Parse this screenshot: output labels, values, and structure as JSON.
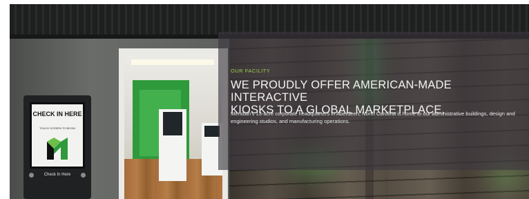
{
  "section": {
    "eyebrow": "OUR FACILITY",
    "headline": "WE PROUDLY OFFER AMERICAN-MADE INTERACTIVE\nKIOSKS TO A GLOBAL MARKETPLACE.",
    "body": "Meridian's 13-acre corporate headquarters in Aberdeen, North Carolina is home to our administrative buildings, design and engineering studios, and manufacturing operations."
  },
  "kiosk": {
    "screen_heading": "CHECK IN HERE",
    "screen_subtext": "TOUCH SCREEN TO BEGIN",
    "cta": "Check In Here"
  },
  "colors": {
    "accent_green": "#9fd14d",
    "overlay": "#3c373f",
    "brand_green": "#2f9a3c"
  }
}
